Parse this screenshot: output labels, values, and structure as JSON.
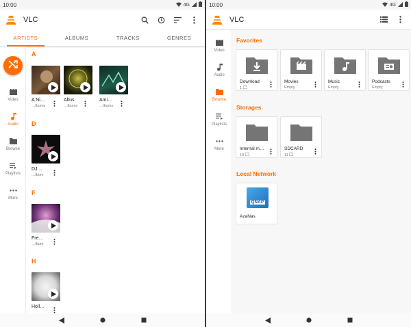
{
  "left": {
    "status": {
      "time": "10:00",
      "network": "4G"
    },
    "appbar": {
      "title": "VLC"
    },
    "tabs": [
      "ARTISTS",
      "ALBUMS",
      "TRACKS",
      "GENRES"
    ],
    "rail": [
      {
        "label": "Video",
        "icon": "video-icon"
      },
      {
        "label": "Audio",
        "icon": "music-note-icon"
      },
      {
        "label": "Browse",
        "icon": "folder-icon"
      },
      {
        "label": "Playlists",
        "icon": "playlist-icon"
      },
      {
        "label": "More",
        "icon": "more-horiz-icon"
      }
    ],
    "sections": [
      {
        "letter": "A",
        "albums": [
          {
            "title": "A Ni…",
            "sub": "…lbums"
          },
          {
            "title": "Altus",
            "sub": "…lbums"
          },
          {
            "title": "Ami…",
            "sub": "…lbums"
          }
        ]
      },
      {
        "letter": "D",
        "albums": [
          {
            "title": "DJ…",
            "sub": "…lbum"
          }
        ]
      },
      {
        "letter": "F",
        "albums": [
          {
            "title": "Fre…",
            "sub": "…lbum"
          }
        ]
      },
      {
        "letter": "H",
        "albums": [
          {
            "title": "Holl…",
            "sub": ""
          }
        ]
      }
    ]
  },
  "right": {
    "status": {
      "time": "10:00",
      "network": "4G"
    },
    "appbar": {
      "title": "VLC"
    },
    "rail": [
      {
        "label": "Video",
        "icon": "video-icon"
      },
      {
        "label": "Audio",
        "icon": "music-note-icon"
      },
      {
        "label": "Browse",
        "icon": "folder-icon"
      },
      {
        "label": "Playlists",
        "icon": "playlist-icon"
      },
      {
        "label": "More",
        "icon": "more-horiz-icon"
      }
    ],
    "favorites": {
      "title": "Favorites",
      "items": [
        {
          "name": "Download",
          "sub": "1",
          "icon": "download-folder-icon"
        },
        {
          "name": "Movies",
          "sub": "Empty",
          "icon": "movie-folder-icon"
        },
        {
          "name": "Music",
          "sub": "Empty",
          "icon": "music-folder-icon"
        },
        {
          "name": "Podcasts",
          "sub": "Empty",
          "icon": "podcast-folder-icon"
        }
      ]
    },
    "storages": {
      "title": "Storages",
      "items": [
        {
          "name": "Internal m…",
          "sub": "10"
        },
        {
          "name": "SDCARD",
          "sub": "11"
        }
      ]
    },
    "network": {
      "title": "Local Network",
      "items": [
        {
          "name": "AzaNas",
          "logo": "QNAP"
        }
      ]
    }
  },
  "colors": {
    "accent": "#ff6d00",
    "folder": "#757575"
  }
}
